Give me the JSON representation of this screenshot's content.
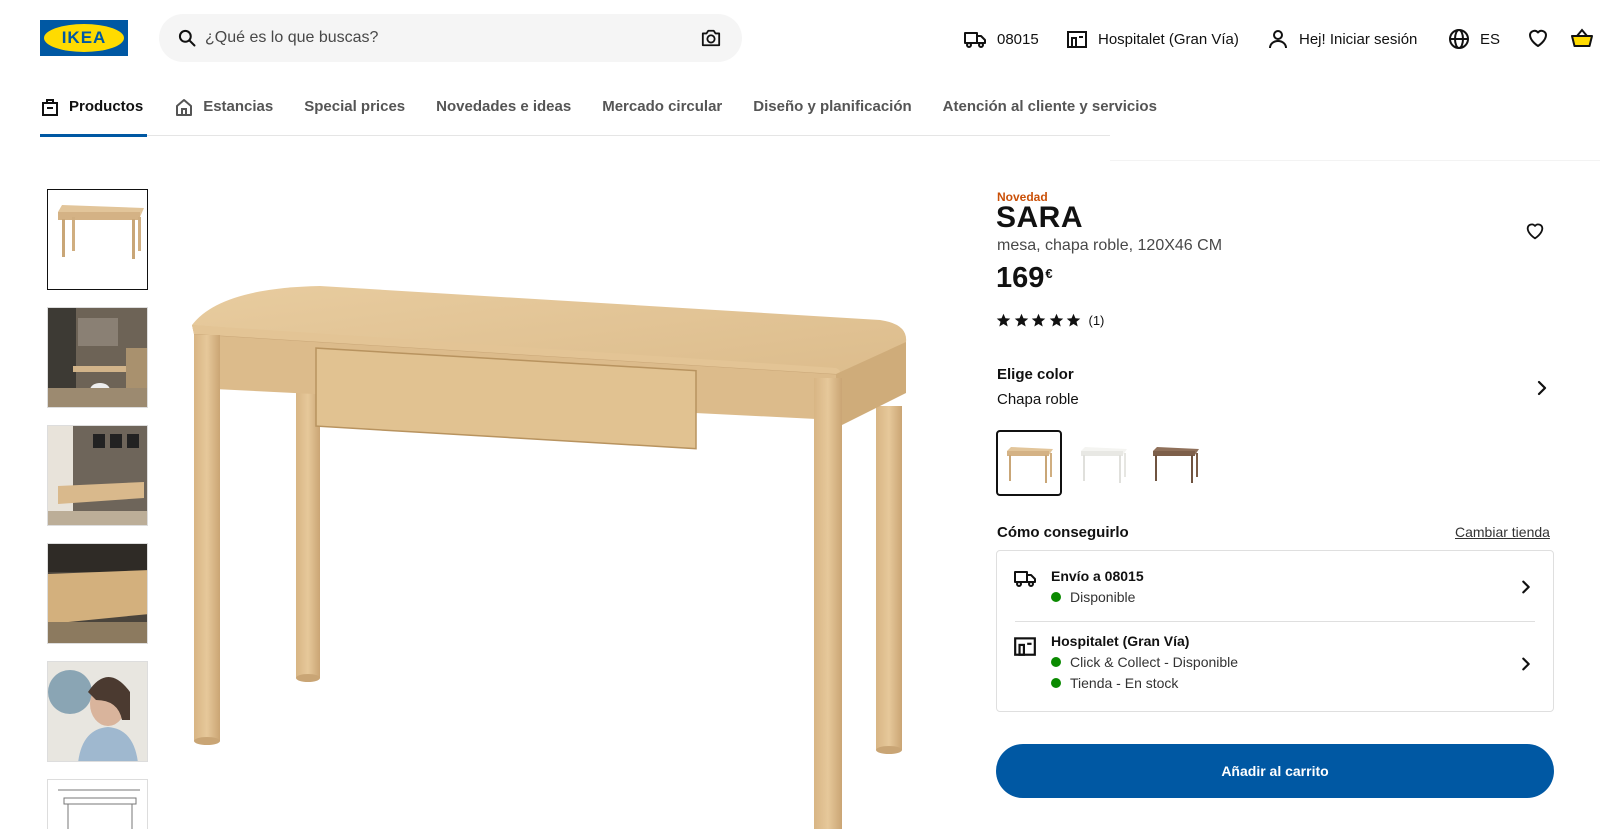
{
  "header": {
    "logo_text": "IKEA",
    "search_placeholder": "¿Qué es lo que buscas?",
    "postcode": "08015",
    "store": "Hospitalet (Gran Vía)",
    "login": "Hej! Iniciar sesión",
    "language": "ES"
  },
  "nav": {
    "items": [
      {
        "label": "Productos",
        "active": true
      },
      {
        "label": "Estancias"
      },
      {
        "label": "Special prices"
      },
      {
        "label": "Novedades e ideas"
      },
      {
        "label": "Mercado circular"
      },
      {
        "label": "Diseño y planificación"
      },
      {
        "label": "Atención al cliente y servicios"
      }
    ]
  },
  "product": {
    "badge": "Novedad",
    "name": "SARA",
    "description": "mesa, chapa roble, 120X46 CM",
    "price": "169",
    "currency": "€",
    "rating": 5,
    "reviews": "(1)",
    "color_title": "Elige color",
    "color_value": "Chapa roble",
    "colors": [
      "#d9b98f",
      "#f2f2ee",
      "#8a6a52"
    ]
  },
  "availability": {
    "title": "Cómo conseguirlo",
    "change_store": "Cambiar tienda",
    "delivery_title": "Envío a 08015",
    "delivery_status": "Disponible",
    "store_title": "Hospitalet (Gran Vía)",
    "click_collect": "Click & Collect - Disponible",
    "store_stock": "Tienda - En stock",
    "status_color": "#0a8a00"
  },
  "actions": {
    "add_to_cart": "Añadir al carrito"
  },
  "colors": {
    "brand_blue": "#0058a3",
    "brand_yellow": "#ffdb00",
    "new_badge": "#ca5008"
  }
}
